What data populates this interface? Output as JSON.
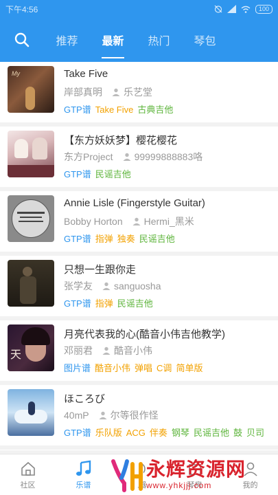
{
  "status": {
    "time": "下午4:56",
    "battery": "100"
  },
  "nav": {
    "tabs": [
      "推荐",
      "最新",
      "热门",
      "琴包"
    ],
    "active_tab": 1
  },
  "songs": [
    {
      "title": "Take Five",
      "artist": "岸部真明",
      "uploader": "乐艺堂",
      "tags": [
        {
          "text": "GTP谱",
          "color": "blue"
        },
        {
          "text": "Take Five",
          "color": "orange"
        },
        {
          "text": "古典吉他",
          "color": "green"
        }
      ]
    },
    {
      "title": "【东方妖妖梦】樱花樱花",
      "artist": "东方Project",
      "uploader": "99999888883咯",
      "tags": [
        {
          "text": "GTP谱",
          "color": "blue"
        },
        {
          "text": "民谣吉他",
          "color": "green"
        }
      ]
    },
    {
      "title": "Annie Lisle (Fingerstyle Guitar)",
      "artist": "Bobby Horton",
      "uploader": "Hermi_黑米",
      "tags": [
        {
          "text": "GTP谱",
          "color": "blue"
        },
        {
          "text": "指弹",
          "color": "orange"
        },
        {
          "text": "独奏",
          "color": "orange"
        },
        {
          "text": "民谣吉他",
          "color": "green"
        }
      ]
    },
    {
      "title": "只想一生跟你走",
      "artist": "张学友",
      "uploader": "sanguosha",
      "tags": [
        {
          "text": "GTP谱",
          "color": "blue"
        },
        {
          "text": "指弹",
          "color": "orange"
        },
        {
          "text": "民谣吉他",
          "color": "green"
        }
      ]
    },
    {
      "title": "月亮代表我的心(酷音小伟吉他教学)",
      "artist": "邓丽君",
      "uploader": "酷音小伟",
      "tags": [
        {
          "text": "图片谱",
          "color": "blue"
        },
        {
          "text": "酷音小伟",
          "color": "orange"
        },
        {
          "text": "弹唱",
          "color": "orange"
        },
        {
          "text": "C调",
          "color": "orange"
        },
        {
          "text": "简单版",
          "color": "orange"
        }
      ]
    },
    {
      "title": "ほころび",
      "artist": "40mP",
      "uploader": "尔等很作怪",
      "tags": [
        {
          "text": "GTP谱",
          "color": "blue"
        },
        {
          "text": "乐队版",
          "color": "orange"
        },
        {
          "text": "ACG",
          "color": "orange"
        },
        {
          "text": "伴奏",
          "color": "orange"
        },
        {
          "text": "钢琴",
          "color": "green"
        },
        {
          "text": "民谣吉他",
          "color": "green"
        },
        {
          "text": "鼓",
          "color": "green"
        },
        {
          "text": "贝司",
          "color": "green"
        }
      ]
    }
  ],
  "bottom_nav": [
    {
      "label": "社区",
      "icon": "home-icon"
    },
    {
      "label": "乐谱",
      "icon": "music-note-icon"
    },
    {
      "label": "乐器",
      "icon": "instrument-icon"
    },
    {
      "label": "琴房",
      "icon": "room-icon"
    },
    {
      "label": "我的",
      "icon": "user-icon"
    }
  ],
  "active_bottom": 1,
  "watermark": {
    "text": "永辉资源网",
    "url": "www.yhkjjj.com"
  },
  "colors": {
    "primary": "#2f96ee",
    "tag_orange": "#f2a100",
    "tag_green": "#5cb43a",
    "watermark_red": "#d9232d"
  }
}
